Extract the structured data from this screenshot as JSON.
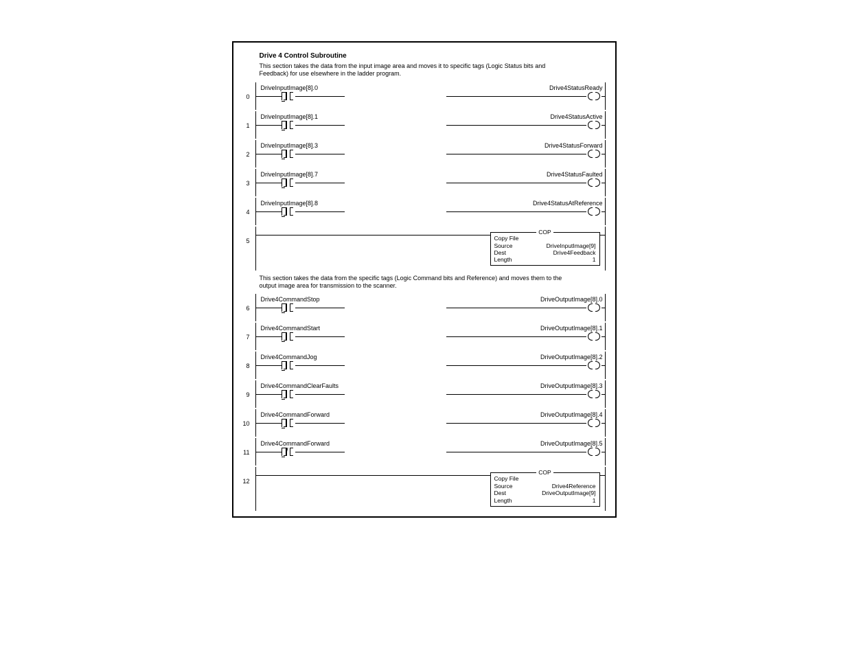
{
  "title": "Drive 4 Control Subroutine",
  "desc1": "This section takes the data from the input image area and moves it to specific tags (Logic Status bits and Feedback) for use elsewhere in the ladder program.",
  "desc2": "This section takes the data from the specific tags (Logic Command bits and Reference) and moves them to the output image area for transmission to the scanner.",
  "rungs": [
    {
      "n": "0",
      "left": "DriveInputImage[8].0",
      "right": "Drive4StatusReady",
      "type": "xic-ote"
    },
    {
      "n": "1",
      "left": "DriveInputImage[8].1",
      "right": "Drive4StatusActive",
      "type": "xic-ote"
    },
    {
      "n": "2",
      "left": "DriveInputImage[8].3",
      "right": "Drive4StatusForward",
      "type": "xic-ote"
    },
    {
      "n": "3",
      "left": "DriveInputImage[8].7",
      "right": "Drive4StatusFaulted",
      "type": "xic-ote"
    },
    {
      "n": "4",
      "left": "DriveInputImage[8].8",
      "right": "Drive4StatusAtReference",
      "type": "xic-ote"
    },
    {
      "n": "5",
      "type": "cop",
      "cop": {
        "name": "COP",
        "hdr": "Copy File",
        "src_l": "Source",
        "src_v": "DriveInputImage[9]",
        "dst_l": "Dest",
        "dst_v": "Drive4Feedback",
        "len_l": "Length",
        "len_v": "1"
      }
    },
    {
      "n": "6",
      "left": "Drive4CommandStop",
      "right": "DriveOutputImage[8].0",
      "type": "xic-ote"
    },
    {
      "n": "7",
      "left": "Drive4CommandStart",
      "right": "DriveOutputImage[8].1",
      "type": "xic-ote"
    },
    {
      "n": "8",
      "left": "Drive4CommandJog",
      "right": "DriveOutputImage[8].2",
      "type": "xic-ote"
    },
    {
      "n": "9",
      "left": "Drive4CommandClearFaults",
      "right": "DriveOutputImage[8].3",
      "type": "xic-ote"
    },
    {
      "n": "10",
      "left": "Drive4CommandForward",
      "right": "DriveOutputImage[8].4",
      "type": "xic-ote"
    },
    {
      "n": "11",
      "left": "Drive4CommandForward",
      "right": "DriveOutputImage[8].5",
      "type": "xio-ote"
    },
    {
      "n": "12",
      "type": "cop",
      "cop": {
        "name": "COP",
        "hdr": "Copy File",
        "src_l": "Source",
        "src_v": "Drive4Reference",
        "dst_l": "Dest",
        "dst_v": "DriveOutputImage[9]",
        "len_l": "Length",
        "len_v": "1"
      }
    }
  ]
}
